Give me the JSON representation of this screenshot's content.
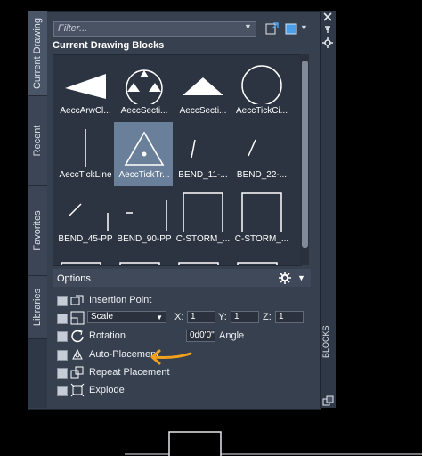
{
  "palette": {
    "tabs": [
      {
        "label": "Current Drawing",
        "active": true
      },
      {
        "label": "Recent",
        "active": false
      },
      {
        "label": "Favorites",
        "active": false
      },
      {
        "label": "Libraries",
        "active": false
      }
    ],
    "filter_placeholder": "Filter...",
    "section_title": "Current Drawing Blocks",
    "title_bar_label": "BLOCKS",
    "blocks": [
      {
        "label": "AeccArwCl...",
        "selected": false
      },
      {
        "label": "AeccSecti...",
        "selected": false
      },
      {
        "label": "AeccSecti...",
        "selected": false
      },
      {
        "label": "AeccTickCi...",
        "selected": false
      },
      {
        "label": "AeccTickLine",
        "selected": false
      },
      {
        "label": "AeccTickTr...",
        "selected": true
      },
      {
        "label": "BEND_11-...",
        "selected": false
      },
      {
        "label": "BEND_22-...",
        "selected": false
      },
      {
        "label": "BEND_45-PP",
        "selected": false
      },
      {
        "label": "BEND_90-PP",
        "selected": false
      },
      {
        "label": "C-STORM_...",
        "selected": false
      },
      {
        "label": "C-STORM_...",
        "selected": false
      }
    ]
  },
  "options": {
    "title": "Options",
    "insertion_point": "Insertion Point",
    "scale_select": "Scale",
    "x_label": "X:",
    "x_value": "1",
    "y_label": "Y:",
    "y_value": "1",
    "z_label": "Z:",
    "z_value": "1",
    "rotation": "Rotation",
    "angle_value": "0d0'0\"",
    "angle_label": "Angle",
    "auto_placement": "Auto-Placement",
    "repeat_placement": "Repeat Placement",
    "explode": "Explode"
  },
  "colors": {
    "panel": "#36404f",
    "selected_block": "#6a7f9a",
    "annotation_arrow": "#f2a11d"
  }
}
